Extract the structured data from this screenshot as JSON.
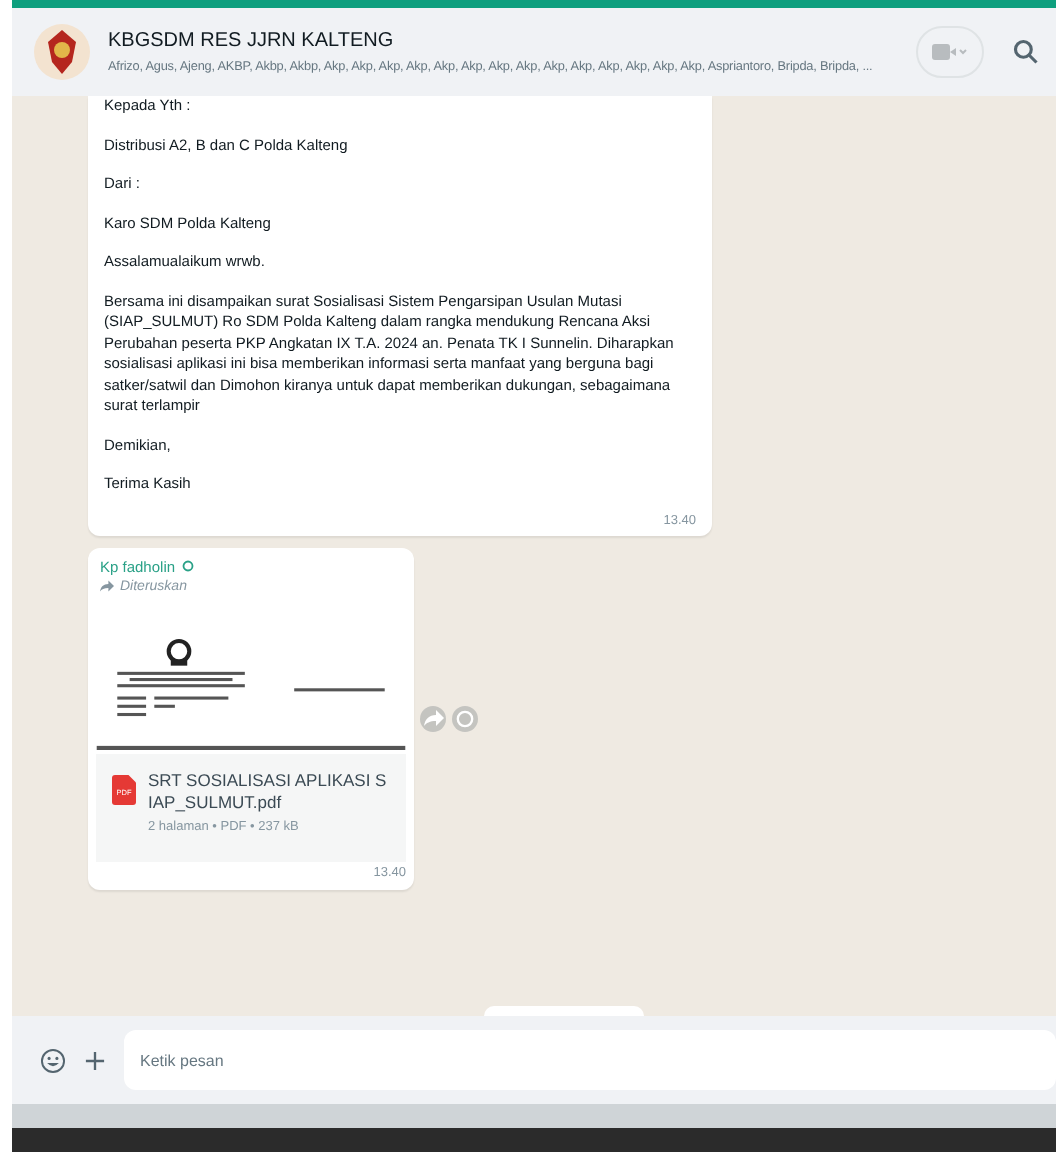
{
  "header": {
    "title": "KBGSDM RES JJRN KALTENG",
    "members": "Afrizo, Agus, Ajeng, AKBP, Akbp, Akbp, Akp, Akp, Akp, Akp, Akp, Akp, Akp, Akp, Akp, Akp, Akp, Akp, Akp, Akp, Aspriantoro, Bripda, Bripda, ..."
  },
  "messages": [
    {
      "kind": "text",
      "paragraphs": [
        "Kepada Yth :",
        "Distribusi A2, B dan C Polda Kalteng",
        "Dari :",
        "Karo SDM Polda Kalteng",
        "Assalamualaikum wrwb.",
        "Bersama ini disampaikan surat Sosialisasi Sistem Pengarsipan Usulan Mutasi (SIAP_SULMUT) Ro SDM Polda Kalteng dalam rangka mendukung Rencana Aksi Perubahan peserta PKP Angkatan IX T.A. 2024 an. Penata TK I Sunnelin. Diharapkan sosialisasi aplikasi ini bisa memberikan informasi serta manfaat yang berguna bagi satker/satwil dan Dimohon kiranya untuk dapat memberikan dukungan, sebagaimana surat terlampir",
        "Demikian,",
        "Terima Kasih"
      ],
      "time": "13.40"
    },
    {
      "kind": "document",
      "sender": "Kp fadholin",
      "forwarded": true,
      "forwarded_label": "Diteruskan",
      "file_name": "SRT SOSIALISASI APLIKASI SIAP_SULMUT.pdf",
      "file_type": "PDF",
      "file_meta": "2 halaman • PDF • 237 kB",
      "time": "13.40"
    }
  ],
  "composer": {
    "placeholder": "Ketik pesan"
  }
}
